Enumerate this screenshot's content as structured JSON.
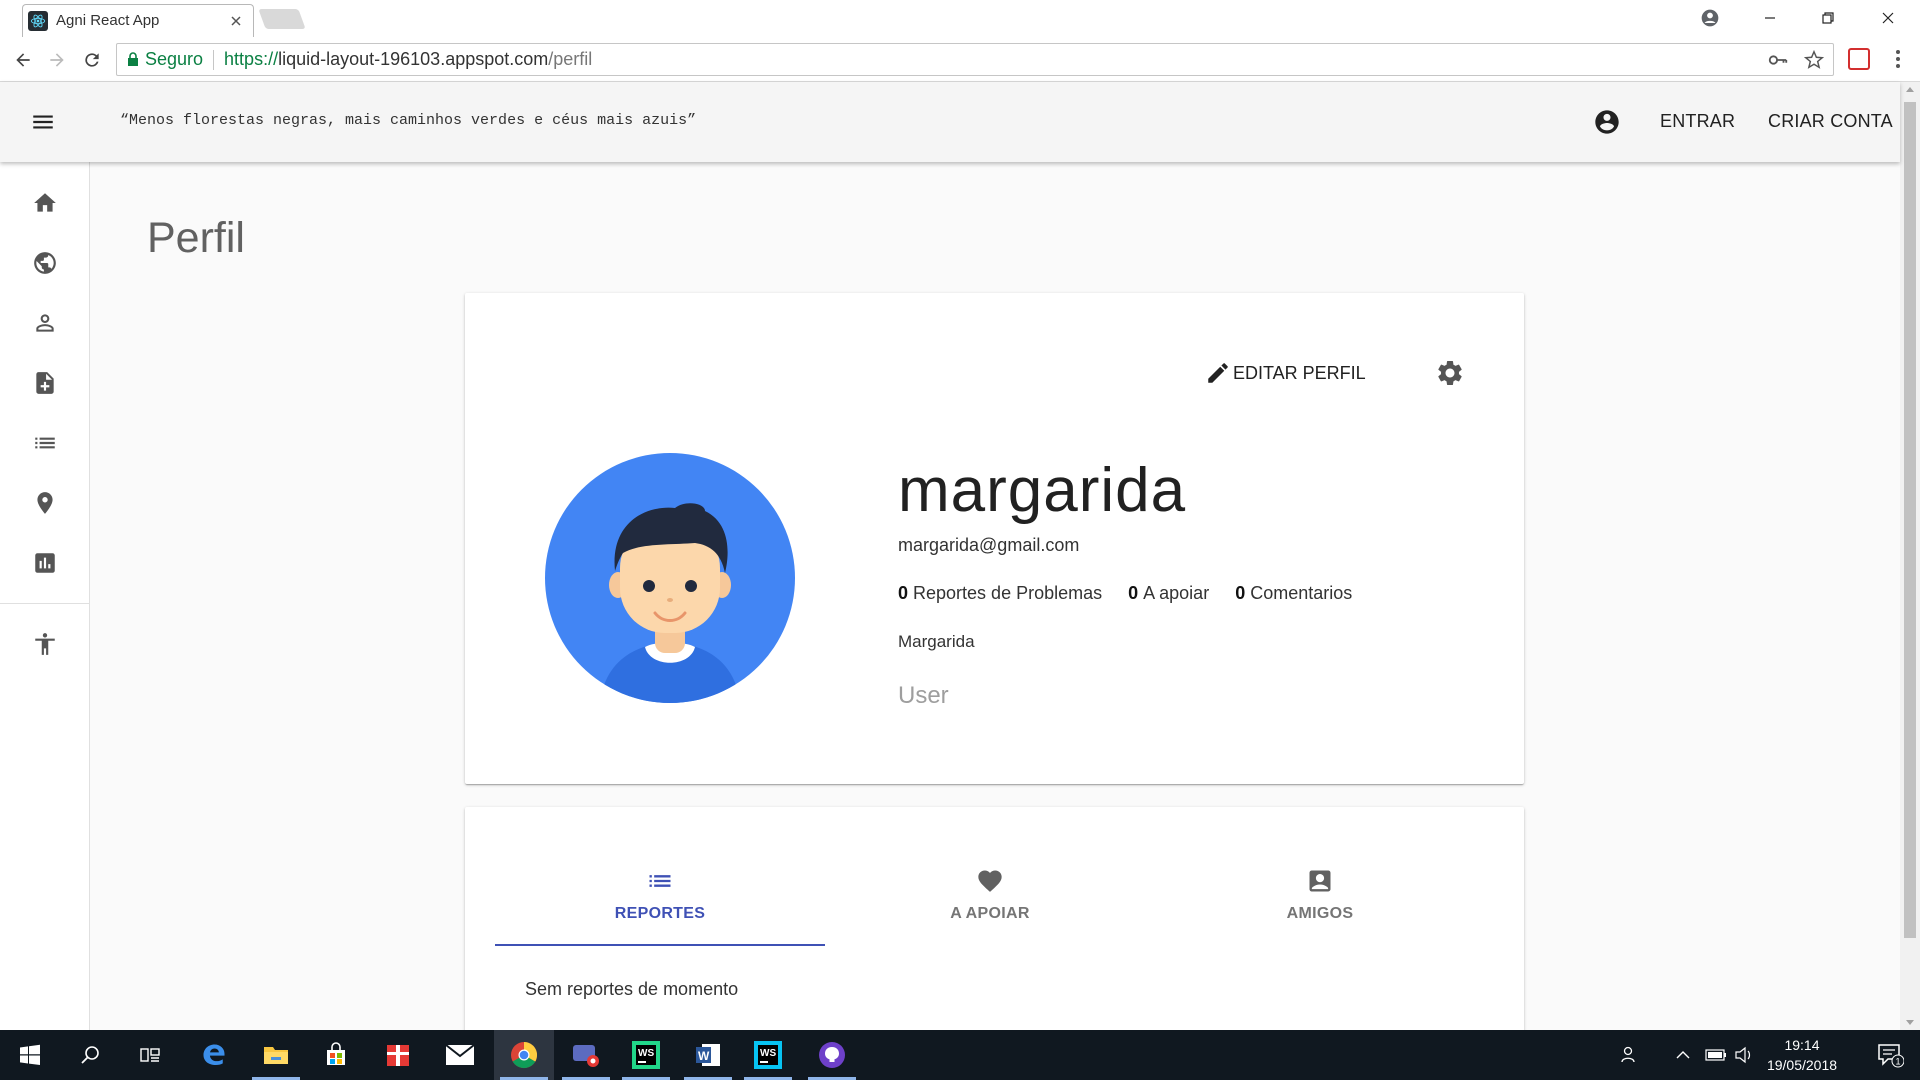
{
  "browser": {
    "tab_title": "Agni React App",
    "secure_label": "Seguro",
    "url_scheme": "https://",
    "url_host": "liquid-layout-196103.appspot.com",
    "url_path": "/perfil"
  },
  "appbar": {
    "quote": "“Menos florestas negras, mais caminhos verdes e céus mais azuis”",
    "login_label": "ENTRAR",
    "signup_label": "CRIAR CONTA"
  },
  "sidebar": {
    "items": [
      {
        "icon": "home-icon"
      },
      {
        "icon": "globe-icon"
      },
      {
        "icon": "person-icon"
      },
      {
        "icon": "note-add-icon"
      },
      {
        "icon": "list-icon"
      },
      {
        "icon": "location-pin-icon"
      },
      {
        "icon": "bar-chart-icon"
      },
      {
        "icon": "accessibility-icon"
      }
    ]
  },
  "page": {
    "title": "Perfil"
  },
  "profile": {
    "edit_label": "EDITAR PERFIL",
    "username": "margarida",
    "email": "margarida@gmail.com",
    "stats": [
      {
        "count": "0",
        "label": "Reportes de Problemas"
      },
      {
        "count": "0",
        "label": "A apoiar"
      },
      {
        "count": "0",
        "label": "Comentarios"
      }
    ],
    "full_name": "Margarida",
    "role": "User"
  },
  "tabs": {
    "items": [
      {
        "label": "REPORTES",
        "icon": "list-icon"
      },
      {
        "label": "A APOIAR",
        "icon": "heart-icon"
      },
      {
        "label": "AMIGOS",
        "icon": "contact-icon"
      }
    ],
    "empty_message": "Sem reportes de momento"
  },
  "taskbar": {
    "time": "19:14",
    "date": "19/05/2018",
    "notification_count": "1"
  },
  "colors": {
    "accent": "#3f51b5",
    "avatar_bg": "#4285f4",
    "secure_green": "#0b8043"
  }
}
